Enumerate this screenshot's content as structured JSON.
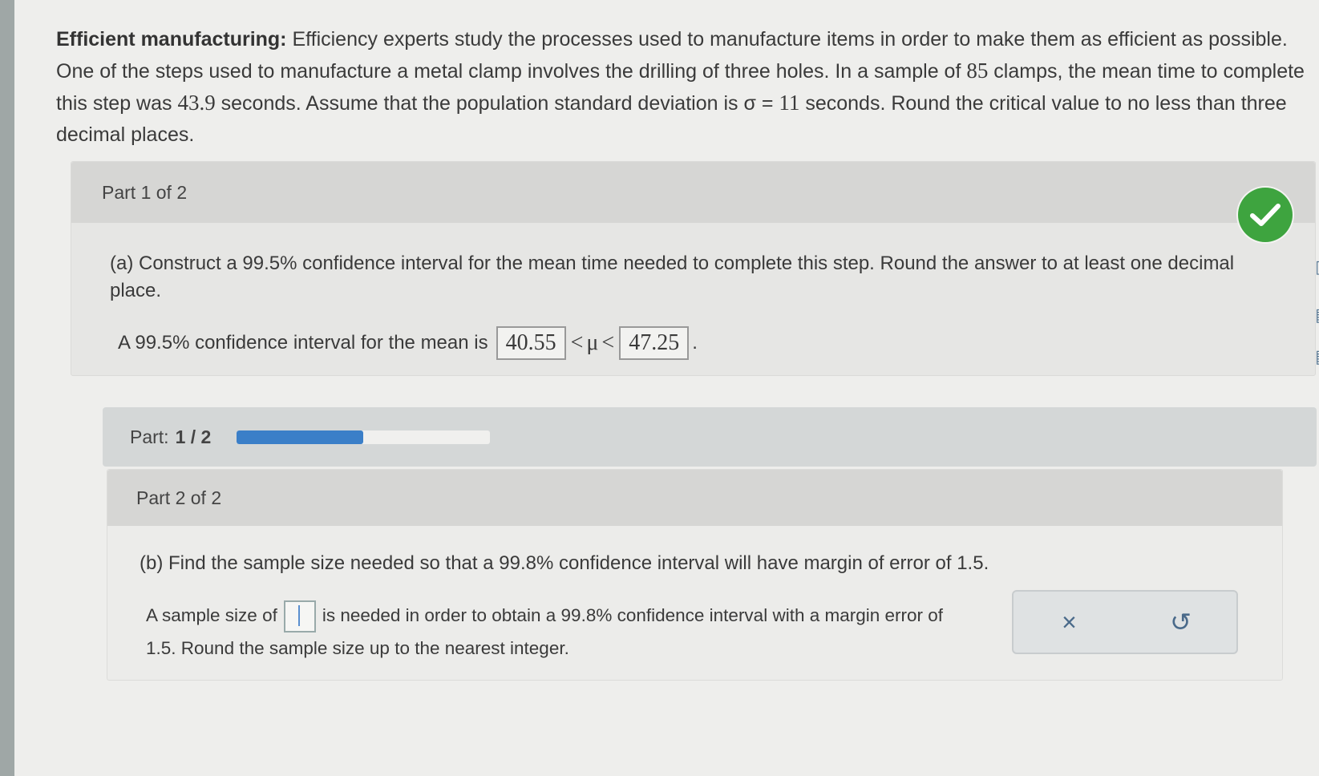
{
  "problem": {
    "title": "Efficient manufacturing:",
    "text_1": " Efficiency experts study the processes used to manufacture items in order to make them as efficient as possible. One of the steps used to manufacture a metal clamp involves the drilling of three holes. In a sample of ",
    "n": "85",
    "text_2": " clamps, the mean time to complete this step was ",
    "mean": "43.9",
    "text_3": " seconds. Assume that the population standard deviation is σ = ",
    "sigma": "11",
    "text_4": " seconds. Round the critical value to no less than three decimal places."
  },
  "part1": {
    "header": "Part 1 of 2",
    "question": "(a) Construct a 99.5% confidence interval for the mean time needed to complete this step. Round the answer to at least one decimal place.",
    "ci_prefix": "A 99.5% confidence interval for the mean is",
    "lower": "40.55",
    "lt1": "<",
    "mu": "μ",
    "lt2": "<",
    "upper": "47.25",
    "period": "."
  },
  "progress": {
    "label": "Part:",
    "value": "1 / 2",
    "fraction": 0.5,
    "color": "#3b7fc8"
  },
  "part2": {
    "header": "Part 2 of 2",
    "question": "(b) Find the sample size needed so that a 99.8% confidence interval will have margin of error of 1.5.",
    "answer_prefix": "A sample size of",
    "answer_suffix": "is needed in order to obtain a 99.8% confidence interval with a margin error of 1.5. Round the sample size up to the nearest integer.",
    "answer_value": ""
  },
  "tools": {
    "clear_icon": "×",
    "undo_icon": "↺"
  },
  "colors": {
    "check": "#3ea43f",
    "accent": "#3b7fc8"
  }
}
